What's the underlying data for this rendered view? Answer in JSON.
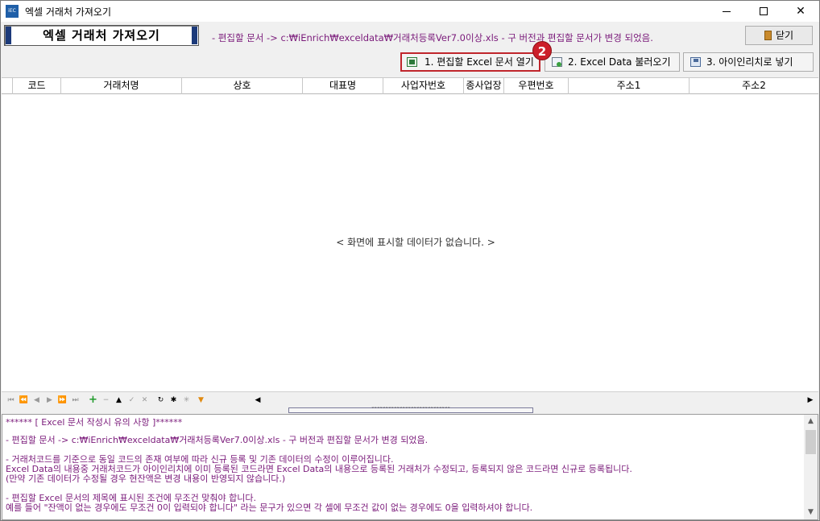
{
  "window": {
    "title": "엑셀 거래처 가져오기",
    "icon_label": "iEC"
  },
  "header": {
    "title_label": "엑셀 거래처 가져오기",
    "path_note": "- 편집할 문서 -> c:₩iEnrich₩exceldata₩거래처등록Ver7.0이상.xls - 구 버전과 편집할 문서가 변경 되었음.",
    "close_label": "닫기"
  },
  "toolbar": {
    "open_excel_label": "1. 편집할 Excel 문서 열기",
    "load_data_label": "2. Excel Data 불러오기",
    "import_label": "3. 아이인리치로 넣기",
    "step_badge": "2"
  },
  "grid": {
    "columns": [
      "코드",
      "거래처명",
      "상호",
      "대표명",
      "사업자번호",
      "종사업장",
      "우편번호",
      "주소1",
      "주소2"
    ],
    "empty_message": "< 화면에 표시할 데이터가 없습니다. >"
  },
  "navigator": {
    "buttons": [
      "first",
      "prev-page",
      "prev",
      "next",
      "next-page",
      "last",
      "add",
      "delete",
      "edit",
      "post",
      "cancel",
      "refresh",
      "bookmark",
      "goto-bookmark",
      "filter"
    ]
  },
  "notes": {
    "lines": [
      "****** [ Excel 문서 작성시 유의 사항 ]******",
      "- 편집할 문서 -> c:₩iEnrich₩exceldata₩거래처등록Ver7.0이상.xls - 구 버전과 편집할 문서가 변경 되었음.",
      "- 거래처코드를 기준으로 동일 코드의 존재 여부에 따라 신규 등록 및 기존 데이터의 수정이 이루어집니다.",
      " Excel Data의 내용중 거래처코드가 아이인리치에 이미 등록된 코드라면 Excel Data의 내용으로 등록된 거래처가 수정되고, 등록되지 않은 코드라면 신규로 등록됩니다.",
      "(만약 기존 데이터가 수정될 경우 현잔액은 변경 내용이 반영되지 않습니다.)",
      "- 편집할 Excel 문서의 제목에 표시된 조건에 무조건 맞춰야 합니다.",
      "예를 들어 \"잔액이 없는 경우에도 무조건 0이 입력되야 합니다\" 라는 문구가 있으면 각 셀에 무조건 값이 없는 경우에도 0을 입력하셔야 합니다."
    ]
  },
  "colors": {
    "accent_red": "#c0262c",
    "note_purple": "#7a1a7a",
    "badge_red": "#cc1f2a"
  }
}
